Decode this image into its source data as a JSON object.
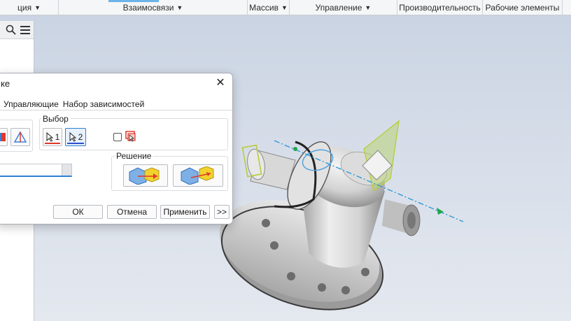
{
  "ribbon": {
    "groups": [
      {
        "label": "ция",
        "has_dropdown": true
      },
      {
        "label": "Взаимосвязи",
        "has_dropdown": true
      },
      {
        "label": "Массив",
        "has_dropdown": true
      },
      {
        "label": "Управление",
        "has_dropdown": true
      },
      {
        "label": "Производительность",
        "has_dropdown": false
      },
      {
        "label": "Рабочие элементы",
        "has_dropdown": false
      }
    ]
  },
  "browser": {
    "icons": [
      "search-icon",
      "menu-icon"
    ]
  },
  "dialog": {
    "title": "ке",
    "close_glyph": "✕",
    "tabs": [
      "Управляющие",
      "Набор зависимостей"
    ],
    "selection": {
      "label": "Выбор",
      "select1": "1",
      "select2": "2",
      "active": 2
    },
    "solution": {
      "label": "Решение"
    },
    "buttons": {
      "ok": "ОК",
      "cancel": "Отмена",
      "apply": "Применить",
      "more": ">>"
    },
    "colors": {
      "accent": "#2f7fd0",
      "mate_red": "#e0382c",
      "mate_yellow": "#f2d22c"
    }
  }
}
